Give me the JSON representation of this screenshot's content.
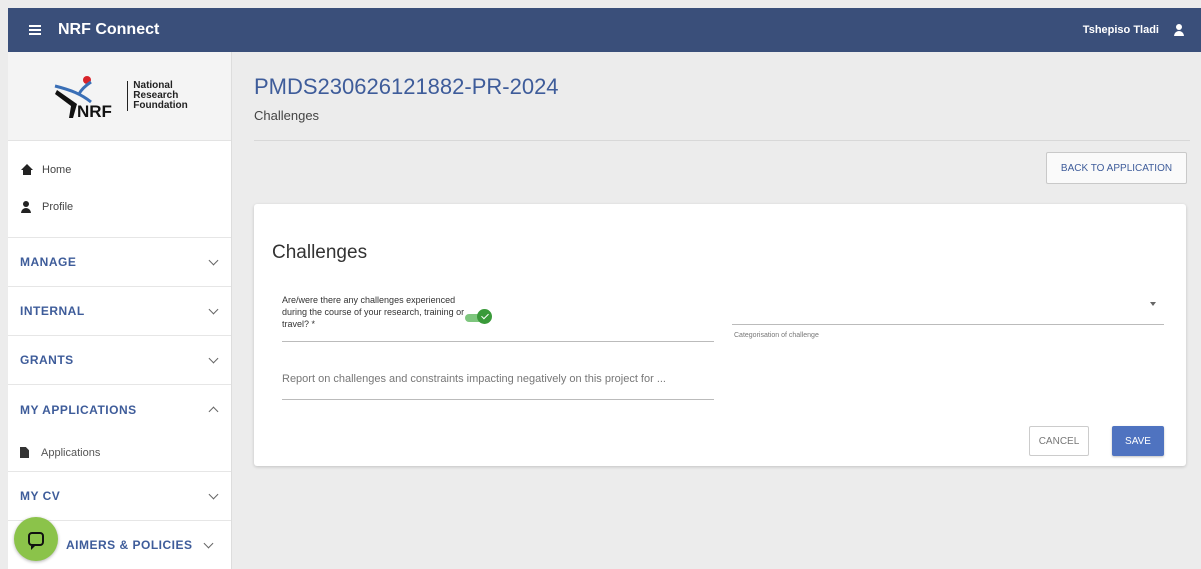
{
  "topbar": {
    "menu_icon": "hamburger-menu-icon",
    "app_title": "NRF Connect",
    "user_name": "Tshepiso Tladi",
    "user_icon": "person-icon"
  },
  "sidebar": {
    "logo": {
      "mark": "NRF",
      "lines": [
        "National",
        "Research",
        "Foundation"
      ]
    },
    "links": [
      {
        "label": "Home",
        "icon": "home-icon"
      },
      {
        "label": "Profile",
        "icon": "person-icon"
      }
    ],
    "sections": [
      {
        "label": "MANAGE",
        "expanded": false
      },
      {
        "label": "INTERNAL",
        "expanded": false
      },
      {
        "label": "GRANTS",
        "expanded": false
      },
      {
        "label": "MY APPLICATIONS",
        "expanded": true,
        "items": [
          {
            "label": "Applications",
            "icon": "document-icon"
          }
        ]
      },
      {
        "label": "MY CV",
        "expanded": false
      },
      {
        "label": "AIMERS & POLICIES",
        "expanded": false
      }
    ]
  },
  "chat": {
    "icon": "chat-bubble-icon"
  },
  "main": {
    "title": "PMDS230626121882-PR-2024",
    "subtitle": "Challenges",
    "back_button": "BACK TO APPLICATION",
    "card": {
      "title": "Challenges",
      "question": "Are/were there any challenges experienced during the course of your research, training or travel? *",
      "toggle_on": true,
      "category_hint": "Categorisation of challenge",
      "report_placeholder": "Report on challenges and constraints impacting negatively on this project for ...",
      "cancel_label": "CANCEL",
      "save_label": "SAVE"
    }
  },
  "colors": {
    "topbar": "#3a4f7a",
    "accent": "#3e5c9a",
    "save": "#4f73c0",
    "toggle": "#3a9a3a",
    "chat": "#8bc34a"
  }
}
